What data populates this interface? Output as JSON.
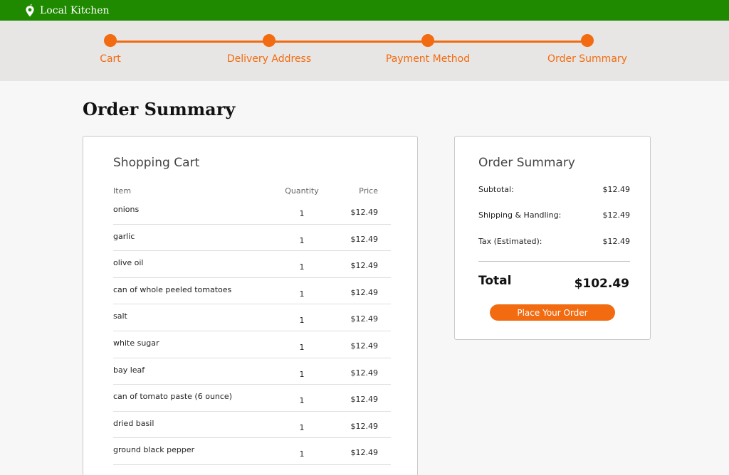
{
  "brand": {
    "name": "Local Kitchen",
    "icon": "map-pin-icon"
  },
  "colors": {
    "brand_green": "#1f8a00",
    "accent_orange": "#f26b10"
  },
  "steps": [
    {
      "label": "Cart"
    },
    {
      "label": "Delivery Address"
    },
    {
      "label": "Payment Method"
    },
    {
      "label": "Order Summary"
    }
  ],
  "page": {
    "title": "Order Summary"
  },
  "cart": {
    "title": "Shopping Cart",
    "headers": {
      "item": "Item",
      "quantity": "Quantity",
      "price": "Price"
    },
    "items": [
      {
        "name": "onions",
        "qty": "1",
        "price": "$12.49"
      },
      {
        "name": "garlic",
        "qty": "1",
        "price": "$12.49"
      },
      {
        "name": "olive oil",
        "qty": "1",
        "price": "$12.49"
      },
      {
        "name": "can of whole peeled tomatoes",
        "qty": "1",
        "price": "$12.49"
      },
      {
        "name": "salt",
        "qty": "1",
        "price": "$12.49"
      },
      {
        "name": "white sugar",
        "qty": "1",
        "price": "$12.49"
      },
      {
        "name": "bay leaf",
        "qty": "1",
        "price": "$12.49"
      },
      {
        "name": "can of tomato paste (6 ounce)",
        "qty": "1",
        "price": "$12.49"
      },
      {
        "name": "dried basil",
        "qty": "1",
        "price": "$12.49"
      },
      {
        "name": "ground black pepper",
        "qty": "1",
        "price": "$12.49"
      }
    ]
  },
  "summary": {
    "title": "Order Summary",
    "subtotal_label": "Subtotal:",
    "subtotal_value": "$12.49",
    "shipping_label": "Shipping & Handling:",
    "shipping_value": "$12.49",
    "tax_label": "Tax (Estimated):",
    "tax_value": "$12.49",
    "total_label": "Total",
    "total_value": "$102.49",
    "place_order_label": "Place Your Order"
  }
}
